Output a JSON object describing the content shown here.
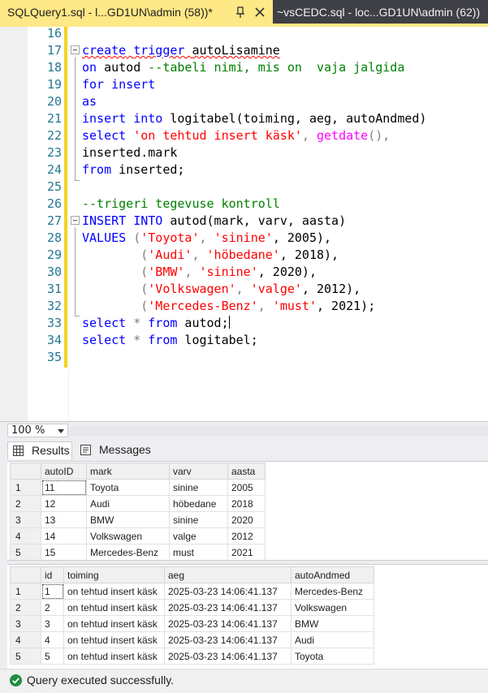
{
  "tabs": {
    "active": {
      "label": "SQLQuery1.sql - l...GD1UN\\admin (58))*"
    },
    "inactive": {
      "label": "~vsCEDC.sql - loc...GD1UN\\admin (62))"
    }
  },
  "editor": {
    "lines": [
      {
        "num": "16"
      },
      {
        "num": "17"
      },
      {
        "num": "18"
      },
      {
        "num": "19"
      },
      {
        "num": "20"
      },
      {
        "num": "21"
      },
      {
        "num": "22"
      },
      {
        "num": "23"
      },
      {
        "num": "24"
      },
      {
        "num": "25"
      },
      {
        "num": "26"
      },
      {
        "num": "27"
      },
      {
        "num": "28"
      },
      {
        "num": "29"
      },
      {
        "num": "30"
      },
      {
        "num": "31"
      },
      {
        "num": "32"
      },
      {
        "num": "33"
      },
      {
        "num": "34"
      },
      {
        "num": "35"
      }
    ],
    "code": {
      "l17": [
        "create",
        " ",
        "trigger",
        " ",
        "autoLisamine"
      ],
      "l18": [
        "on",
        " autod ",
        "--tabeli nimi, mis on  vaja jalgida"
      ],
      "l19": [
        "for",
        " ",
        "insert"
      ],
      "l20": [
        "as"
      ],
      "l21": [
        "insert",
        " ",
        "into",
        " logitabel(toiming, aeg, autoAndmed)"
      ],
      "l22": [
        "select",
        " ",
        "'on tehtud insert käsk'",
        ", ",
        "getdate",
        "(),"
      ],
      "l23": [
        "inserted",
        ".mark"
      ],
      "l24": [
        "from",
        " inserted;"
      ],
      "l26": [
        "--trigeri tegevuse kontroll"
      ],
      "l27": [
        "INSERT",
        " ",
        "INTO",
        " autod(mark, varv, aasta)"
      ],
      "l28": [
        "VALUES",
        " (",
        "'Toyota'",
        ", ",
        "'sinine'",
        ", 2005),"
      ],
      "l29": [
        "        (",
        "'Audi'",
        ", ",
        "'höbedane'",
        ", 2018),"
      ],
      "l30": [
        "        (",
        "'BMW'",
        ", ",
        "'sinine'",
        ", 2020),"
      ],
      "l31": [
        "        (",
        "'Volkswagen'",
        ", ",
        "'valge'",
        ", 2012),"
      ],
      "l32": [
        "        (",
        "'Mercedes-Benz'",
        ", ",
        "'must'",
        ", 2021);"
      ],
      "l33": [
        "select",
        " ",
        "*",
        " ",
        "from",
        " autod;"
      ],
      "l34": [
        "select",
        " ",
        "*",
        " ",
        "from",
        " logitabel;"
      ]
    }
  },
  "zoom": {
    "value": "100 %"
  },
  "result_tabs": {
    "results": "Results",
    "messages": "Messages"
  },
  "grid1": {
    "columns": [
      "autoID",
      "mark",
      "varv",
      "aasta"
    ],
    "rows": [
      {
        "n": "1",
        "cells": [
          "11",
          "Toyota",
          "sinine",
          "2005"
        ]
      },
      {
        "n": "2",
        "cells": [
          "12",
          "Audi",
          "höbedane",
          "2018"
        ]
      },
      {
        "n": "3",
        "cells": [
          "13",
          "BMW",
          "sinine",
          "2020"
        ]
      },
      {
        "n": "4",
        "cells": [
          "14",
          "Volkswagen",
          "valge",
          "2012"
        ]
      },
      {
        "n": "5",
        "cells": [
          "15",
          "Mercedes-Benz",
          "must",
          "2021"
        ]
      }
    ]
  },
  "grid2": {
    "columns": [
      "id",
      "toiming",
      "aeg",
      "autoAndmed"
    ],
    "rows": [
      {
        "n": "1",
        "cells": [
          "1",
          "on tehtud insert käsk",
          "2025-03-23 14:06:41.137",
          "Mercedes-Benz"
        ]
      },
      {
        "n": "2",
        "cells": [
          "2",
          "on tehtud insert käsk",
          "2025-03-23 14:06:41.137",
          "Volkswagen"
        ]
      },
      {
        "n": "3",
        "cells": [
          "3",
          "on tehtud insert käsk",
          "2025-03-23 14:06:41.137",
          "BMW"
        ]
      },
      {
        "n": "4",
        "cells": [
          "4",
          "on tehtud insert käsk",
          "2025-03-23 14:06:41.137",
          "Audi"
        ]
      },
      {
        "n": "5",
        "cells": [
          "5",
          "on tehtud insert käsk",
          "2025-03-23 14:06:41.137",
          "Toyota"
        ]
      }
    ]
  },
  "status": {
    "text": "Query executed successfully."
  },
  "colors": {
    "tab_active": "#ffe886",
    "keyword": "#0000ff",
    "string": "#ff0000",
    "comment": "#008000",
    "function": "#ff00ff",
    "success": "#1e8e3e"
  }
}
